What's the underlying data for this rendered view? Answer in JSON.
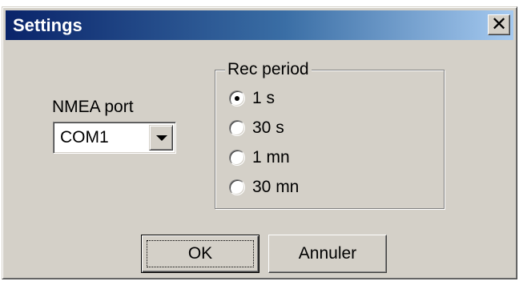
{
  "window": {
    "title": "Settings",
    "close_glyph": "✕"
  },
  "nmea": {
    "label": "NMEA port",
    "value": "COM1"
  },
  "rec_period": {
    "legend": "Rec period",
    "options": [
      "1 s",
      "30 s",
      "1 mn",
      "30 mn"
    ],
    "selected": "1 s"
  },
  "buttons": {
    "ok_label": "OK",
    "cancel_label": "Annuler"
  },
  "colors": {
    "face": "#d4d0c8",
    "title_start": "#0a246a",
    "title_end": "#a6caf0",
    "title_text": "#ffffff"
  }
}
